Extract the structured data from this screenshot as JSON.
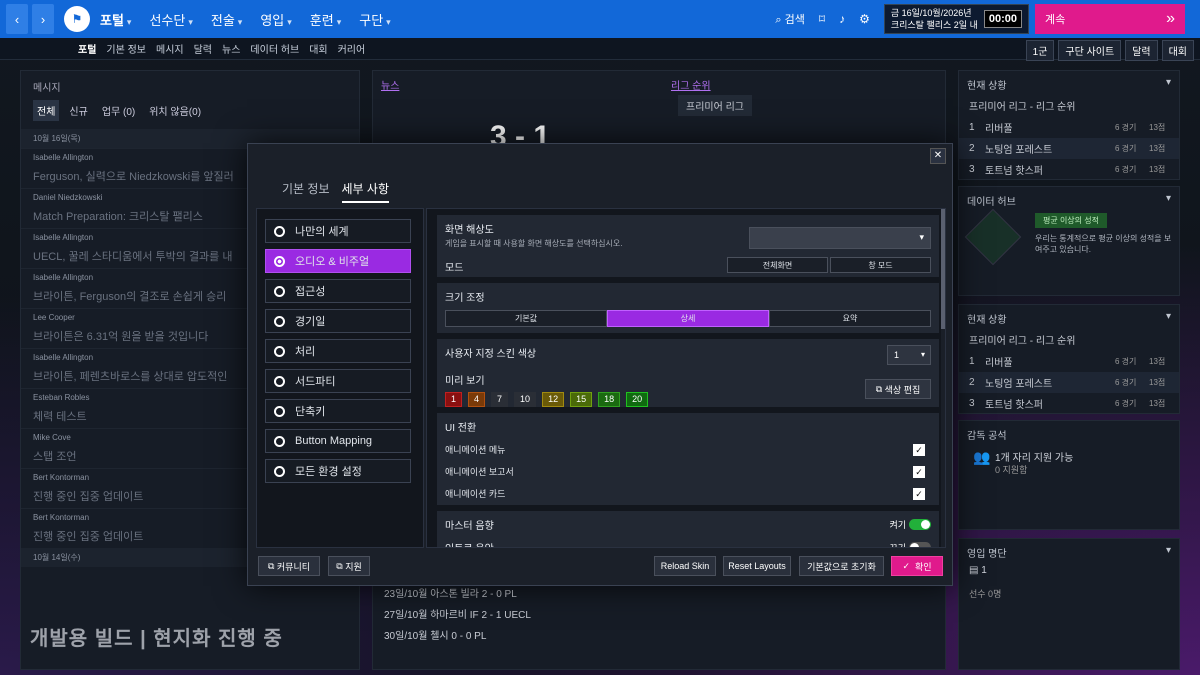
{
  "topnav": {
    "back": "‹",
    "fwd": "›",
    "menu": [
      {
        "label": "포털",
        "on": true
      },
      {
        "label": "선수단",
        "on": false
      },
      {
        "label": "전술",
        "on": false
      },
      {
        "label": "영입",
        "on": false
      },
      {
        "label": "훈련",
        "on": false
      },
      {
        "label": "구단",
        "on": false
      }
    ],
    "search": "검색",
    "date_line1": "금 16일/10월/2026년",
    "date_line2": "크리스탈 팰리스 2일 내",
    "time": "00:00",
    "continue": "계속",
    "continue_icon": "»"
  },
  "subnav": {
    "items": [
      "포털",
      "기본 정보",
      "메시지",
      "달력",
      "뉴스",
      "데이터 허브",
      "대회",
      "커리어"
    ],
    "right": [
      "1군",
      "구단 사이트",
      "달력",
      "대회"
    ]
  },
  "messages": {
    "title": "메시지",
    "tabs": [
      "전체",
      "신규",
      "업무 (0)",
      "위치 않음(0)"
    ],
    "day1": "10월 16일(목)",
    "items": [
      {
        "from": "Isabelle Allington",
        "subj": "Ferguson, 실력으로 Niedzkowski를 앞질러"
      },
      {
        "from": "Daniel Niedzkowski",
        "subj": "Match Preparation: 크리스탈 팰리스"
      },
      {
        "from": "Isabelle Allington",
        "subj": "UECL, 꿀레 스타디움에서 투박의 결과를 내"
      },
      {
        "from": "Isabelle Allington",
        "subj": "브라이튼, Ferguson의 결조로 손쉽게 승리"
      },
      {
        "from": "Lee Cooper",
        "subj": "브라이튼은 6.31억 원을 받을 것입니다"
      },
      {
        "from": "Isabelle Allington",
        "subj": "브라이튼, 페렌츠바로스를 상대로 압도적인"
      },
      {
        "from": "Esteban Robles",
        "subj": "체력 테스트"
      },
      {
        "from": "Mike Cove",
        "subj": "스탭 조언"
      },
      {
        "from": "Bert Kontorman",
        "subj": "진행 중인 집중 업데이트"
      },
      {
        "from": "Bert Kontorman",
        "subj": "진행 중인 집중 업데이트"
      }
    ],
    "day2": "10월 14일(수)"
  },
  "watermark": "개발용 빌드 | 현지화 진행 중",
  "middle": {
    "news": "뉴스",
    "league": "리그 순위",
    "league_name": "프리미어 리그",
    "score": "3 - 1",
    "rows": [
      "23일/10월  아스톤 빌라  2 - 0  PL",
      "27일/10월  하마르비 IF  2 - 1  UECL",
      "30일/10월  첼시  0 - 0  PL"
    ]
  },
  "right": {
    "standing_title": "현재 상황",
    "standing_sub": "프리미어 리그 - 리그 순위",
    "standings": [
      {
        "pos": "1",
        "team": "리버풀",
        "g": "6 경기",
        "p": "13점"
      },
      {
        "pos": "2",
        "team": "노팅엄 포레스트",
        "g": "6 경기",
        "p": "13점"
      },
      {
        "pos": "3",
        "team": "토트넘 핫스퍼",
        "g": "6 경기",
        "p": "13점"
      }
    ],
    "datahub_title": "데이터 허브",
    "datahub_badge": "평균 이상의 성적",
    "datahub_text": "우리는 통계적으로 평균 이상의 성적을 보여주고 있습니다.",
    "staff_title": "감독 공석",
    "staff_text": "1개 자리 지원 가능",
    "staff_sub": "0 지원함",
    "roster_title": "영입 명단",
    "roster_count": "1",
    "roster_sub": "선수 0명"
  },
  "modal": {
    "tabs": [
      "기본 정보",
      "세부 사항"
    ],
    "nav": [
      "나만의 세계",
      "오디오 & 비주얼",
      "접근성",
      "경기일",
      "처리",
      "서드파티",
      "단축키",
      "Button Mapping",
      "모든 환경 설정"
    ],
    "resolution": {
      "title": "화면 해상도",
      "desc": "게임을 표시할 때 사용할 화면 해상도를 선택하십시오.",
      "mode": "모드",
      "fullscreen": "전체화면",
      "window": "창 모드"
    },
    "sizing": {
      "title": "크기 조정",
      "opts": [
        "기본값",
        "상세",
        "요약"
      ]
    },
    "skin": {
      "title": "사용자 지정 스킨 색상",
      "value": "1",
      "preview": "미리 보기",
      "chips": [
        "1",
        "4",
        "7",
        "10",
        "12",
        "15",
        "18",
        "20"
      ],
      "edit": "색상 편집"
    },
    "ui": {
      "title": "UI 전환",
      "items": [
        "애니메이션 메뉴",
        "애니메이션 보고서",
        "애니메이션 카드"
      ]
    },
    "sound": {
      "title": "마스터 음향",
      "on": "켜기",
      "sub": "인트로 음악",
      "off": "끄기"
    },
    "footer": {
      "community": "커뮤니티",
      "support": "지원",
      "reload": "Reload Skin",
      "reset_layouts": "Reset Layouts",
      "reset_default": "기본값으로 초기화",
      "ok": "확인"
    }
  },
  "colors": {
    "accent": "#9a2ae2",
    "confirm": "#e01a8c",
    "nav": "#1268d8"
  }
}
